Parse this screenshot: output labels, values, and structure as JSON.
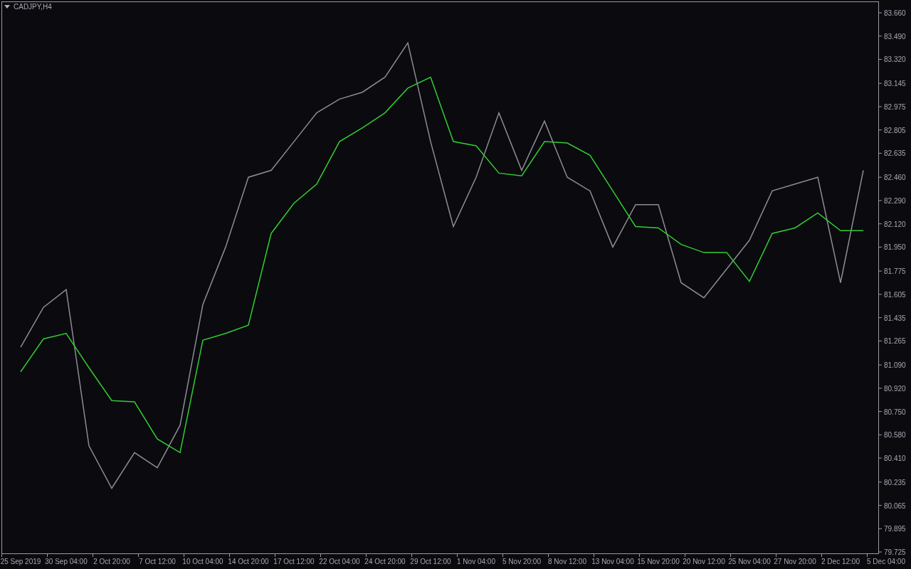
{
  "window": {
    "title": "CADJPY,H4"
  },
  "chart": {
    "chart_data": {
      "type": "line",
      "ylim": [
        79.715,
        83.743
      ],
      "categories": [
        null,
        "25 Sep 2019",
        null,
        "30 Sep 04:00",
        null,
        "2 Oct 20:00",
        null,
        "7 Oct 12:00",
        null,
        "10 Oct 04:00",
        null,
        "14 Oct 20:00",
        null,
        "17 Oct 12:00",
        null,
        "22 Oct 04:00",
        null,
        "24 Oct 20:00",
        null,
        "29 Oct 12:00",
        null,
        "1 Nov 04:00",
        null,
        "5 Nov 20:00",
        null,
        "8 Nov 12:00",
        null,
        "13 Nov 04:00",
        null,
        "15 Nov 20:00",
        null,
        "20 Nov 12:00",
        null,
        "25 Nov 04:00",
        null,
        "27 Nov 20:00",
        null,
        "2 Dec 12:00",
        null,
        "5 Dec 04:00"
      ],
      "series": [
        {
          "color": "#8c8c94",
          "values": [
            null,
            81.22,
            81.51,
            81.64,
            80.5,
            80.19,
            80.45,
            80.34,
            80.65,
            81.53,
            81.95,
            82.46,
            82.51,
            82.72,
            82.93,
            83.03,
            83.08,
            83.19,
            83.44,
            82.72,
            82.1,
            82.46,
            82.93,
            82.51,
            82.87,
            82.46,
            82.36,
            81.95,
            82.26,
            82.26,
            81.69,
            81.58,
            81.79,
            82.0,
            82.36,
            82.41,
            82.46,
            81.69,
            82.51,
            null
          ]
        },
        {
          "color": "#32cd32",
          "values": [
            null,
            81.04,
            81.28,
            81.32,
            81.07,
            80.83,
            80.82,
            80.55,
            80.45,
            81.27,
            81.32,
            81.38,
            82.05,
            82.27,
            82.41,
            82.72,
            82.82,
            82.93,
            83.11,
            83.19,
            82.72,
            82.69,
            82.49,
            82.47,
            82.72,
            82.71,
            82.62,
            82.36,
            82.1,
            82.09,
            81.97,
            81.91,
            81.91,
            81.7,
            82.05,
            82.09,
            82.2,
            82.07,
            82.07,
            null
          ]
        }
      ],
      "yticks": [
        {
          "value": 83.66,
          "label": "83.660"
        },
        {
          "value": 83.49,
          "label": "83.490"
        },
        {
          "value": 83.32,
          "label": "83.320"
        },
        {
          "value": 83.145,
          "label": "83.145"
        },
        {
          "value": 82.975,
          "label": "82.975"
        },
        {
          "value": 82.805,
          "label": "82.805"
        },
        {
          "value": 82.635,
          "label": "82.635"
        },
        {
          "value": 82.46,
          "label": "82.460"
        },
        {
          "value": 82.29,
          "label": "82.290"
        },
        {
          "value": 82.12,
          "label": "82.120"
        },
        {
          "value": 81.95,
          "label": "81.950"
        },
        {
          "value": 81.775,
          "label": "81.775"
        },
        {
          "value": 81.605,
          "label": "81.605"
        },
        {
          "value": 81.435,
          "label": "81.435"
        },
        {
          "value": 81.265,
          "label": "81.265"
        },
        {
          "value": 81.09,
          "label": "81.090"
        },
        {
          "value": 80.92,
          "label": "80.920"
        },
        {
          "value": 80.75,
          "label": "80.750"
        },
        {
          "value": 80.58,
          "label": "80.580"
        },
        {
          "value": 80.41,
          "label": "80.410"
        },
        {
          "value": 80.235,
          "label": "80.235"
        },
        {
          "value": 80.065,
          "label": "80.065"
        },
        {
          "value": 79.895,
          "label": "79.895"
        },
        {
          "value": 79.725,
          "label": "79.725"
        }
      ]
    }
  }
}
